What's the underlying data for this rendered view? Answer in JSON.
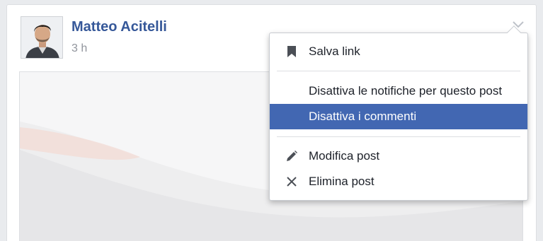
{
  "post": {
    "author": "Matteo Acitelli",
    "time": "3 h"
  },
  "menu": {
    "items": [
      {
        "label": "Salva link",
        "icon": "bookmark-icon"
      },
      {
        "label": "Disattiva le notifiche per questo post",
        "icon": ""
      },
      {
        "label": "Disattiva i commenti",
        "icon": "",
        "highlighted": true
      },
      {
        "label": "Modifica post",
        "icon": "pencil-icon"
      },
      {
        "label": "Elimina post",
        "icon": "close-icon"
      }
    ]
  },
  "colors": {
    "brand_link": "#365899",
    "highlight": "#4267b2",
    "muted_text": "#90949c"
  }
}
